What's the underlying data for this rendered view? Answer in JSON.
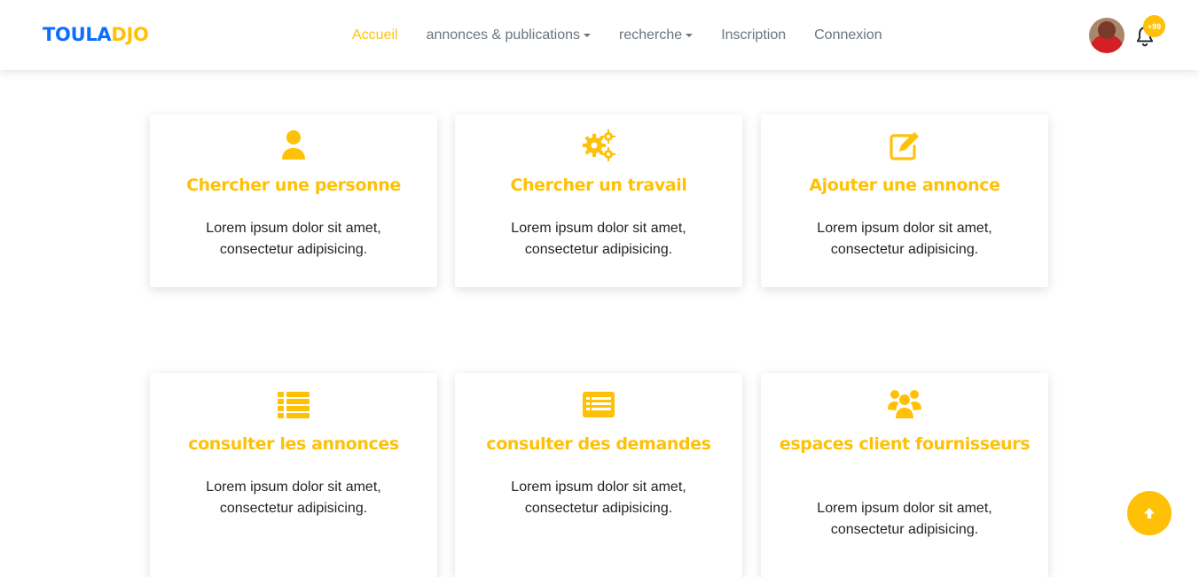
{
  "brand": {
    "part1": "TOULA",
    "part2": "DJO"
  },
  "nav": {
    "items": [
      {
        "label": "Accueil"
      },
      {
        "label": "annonces & publications"
      },
      {
        "label": "recherche"
      },
      {
        "label": "Inscription"
      },
      {
        "label": "Connexion"
      }
    ]
  },
  "notifications": {
    "count": "+99"
  },
  "cards": [
    {
      "icon": "user-icon",
      "title": "Chercher une personne",
      "text": "Lorem ipsum dolor sit amet, consectetur adipisicing."
    },
    {
      "icon": "gears-icon",
      "title": "Chercher un travail",
      "text": "Lorem ipsum dolor sit amet, consectetur adipisicing."
    },
    {
      "icon": "edit-icon",
      "title": "Ajouter une annonce",
      "text": "Lorem ipsum dolor sit amet, consectetur adipisicing."
    },
    {
      "icon": "list-icon",
      "title": "consulter les annonces",
      "text": "Lorem ipsum dolor sit amet, consectetur adipisicing."
    },
    {
      "icon": "list-alt-icon",
      "title": "consulter des demandes",
      "text": "Lorem ipsum dolor sit amet, consectetur adipisicing."
    },
    {
      "icon": "users-icon",
      "title": "espaces client fournisseurs",
      "text": "Lorem ipsum dolor sit amet, consectetur adipisicing."
    }
  ],
  "colors": {
    "accent": "#ffc107",
    "brand_blue": "#0d6efd",
    "nav_text": "#6c757d",
    "body_text": "#212529"
  }
}
